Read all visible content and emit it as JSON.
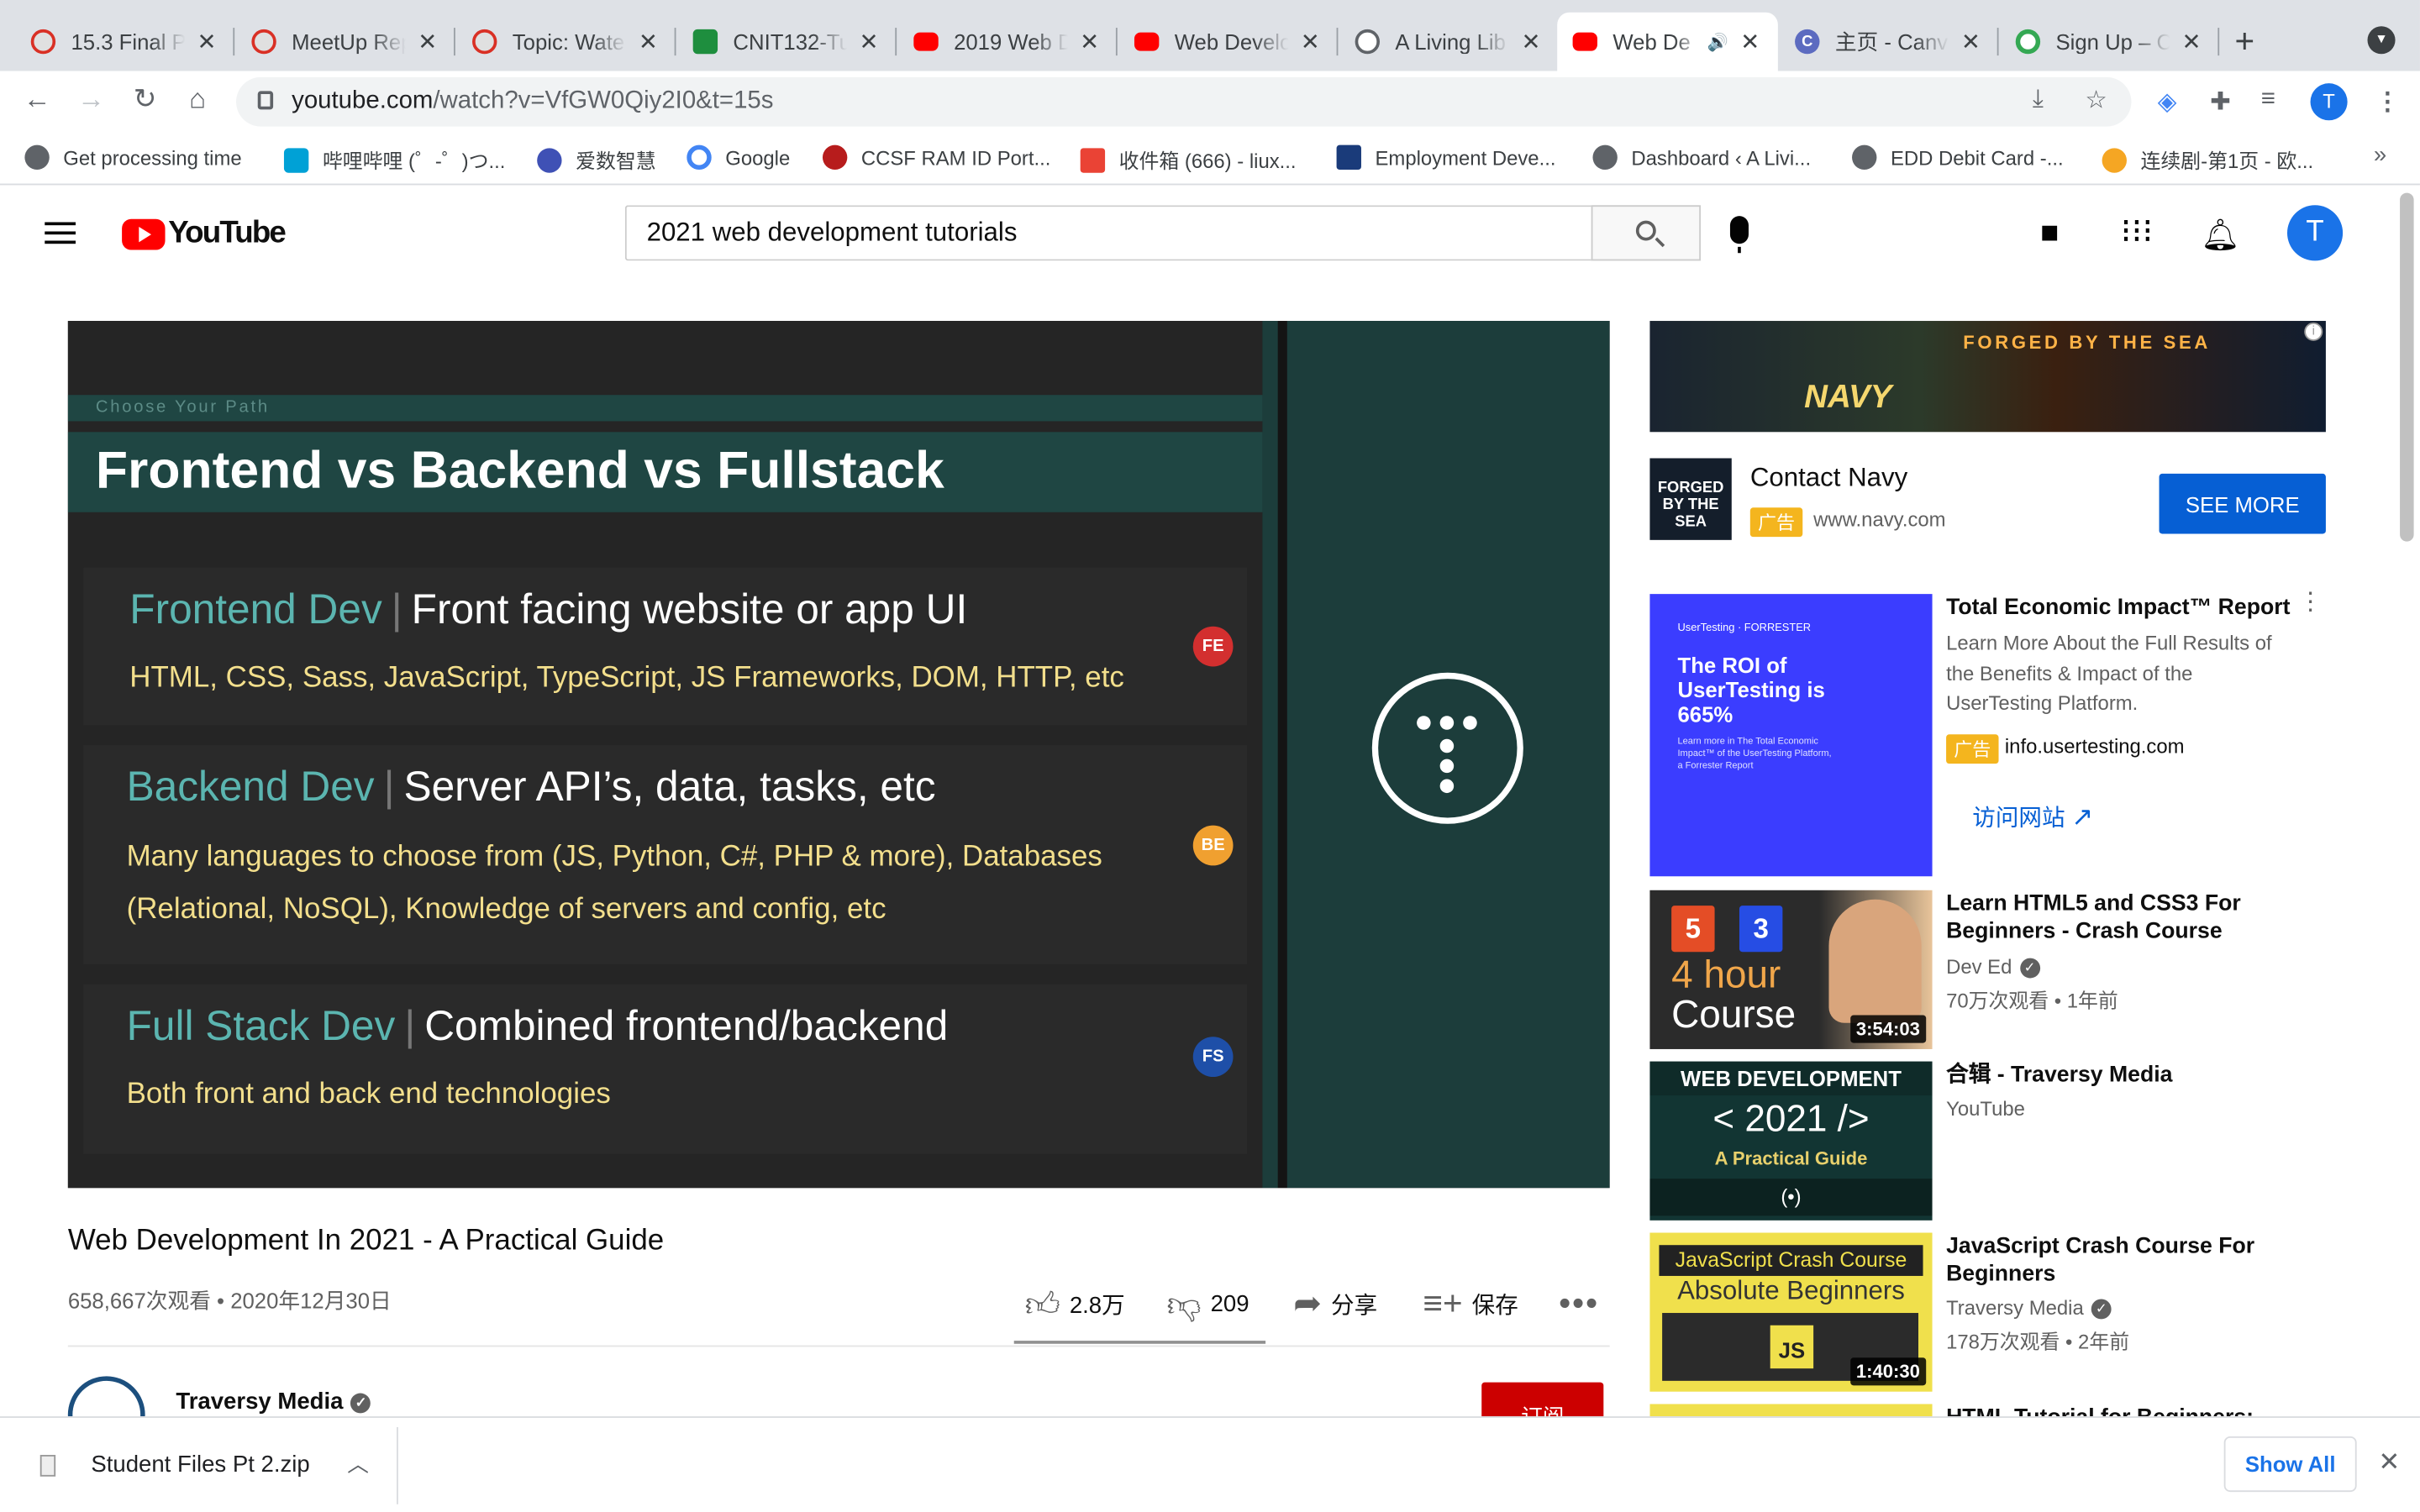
{
  "browser": {
    "tabs": [
      {
        "title": "15.3 Final P",
        "icon": "cube-icon"
      },
      {
        "title": "MeetUp Rep",
        "icon": "cube-icon"
      },
      {
        "title": "Topic: Wate",
        "icon": "cube-icon"
      },
      {
        "title": "CNIT132-Tu",
        "icon": "sheets-icon"
      },
      {
        "title": "2019 Web D",
        "icon": "youtube-icon"
      },
      {
        "title": "Web Develo",
        "icon": "youtube-icon"
      },
      {
        "title": "A Living Lib",
        "icon": "globe-icon"
      },
      {
        "title": "Web De",
        "icon": "youtube-icon",
        "active": true,
        "audio": "🔊"
      },
      {
        "title": "主页 - Canv",
        "icon": "canva-icon"
      },
      {
        "title": "Sign Up – C",
        "icon": "grammarly-icon"
      }
    ],
    "close_glyph": "✕",
    "new_tab_glyph": "+",
    "url_host": "youtube.com",
    "url_path": "/watch?v=VfGW0Qiy2I0&t=15s",
    "profile_initial": "T",
    "bookmarks": [
      {
        "label": "Get processing time",
        "color": "#5f6368"
      },
      {
        "label": "哔哩哔哩 (゜-゜)つ...",
        "color": "#00a1d6"
      },
      {
        "label": "爱数智慧",
        "color": "#3f51b5"
      },
      {
        "label": "Google",
        "color": "#4285f4"
      },
      {
        "label": "CCSF RAM ID Port...",
        "color": "#b71c1c"
      },
      {
        "label": "收件箱 (666) - liux...",
        "color": "#ea4335"
      },
      {
        "label": "Employment Deve...",
        "color": "#1a3b7a"
      },
      {
        "label": "Dashboard ‹ A Livi...",
        "color": "#5f6368"
      },
      {
        "label": "EDD Debit Card -...",
        "color": "#5f6368"
      },
      {
        "label": "连续剧-第1页 - 欧...",
        "color": "#f5a623"
      }
    ],
    "bookmarks_more": "»"
  },
  "youtube": {
    "logo_text": "YouTube",
    "search_value": "2021 web development tutorials",
    "avatar_initial": "T"
  },
  "slide": {
    "kicker": "Choose Your Path",
    "title": "Frontend vs Backend vs Fullstack",
    "rows": [
      {
        "accent": "Frontend Dev",
        "pipe": "|",
        "head": "Front facing website or app UI",
        "body": [
          "HTML, CSS, Sass, JavaScript, TypeScript, JS Frameworks, DOM, HTTP, etc"
        ],
        "badge": "FE",
        "badge_color": "#d32f2f"
      },
      {
        "accent": "Backend Dev",
        "pipe": "|",
        "head": "Server API’s, data, tasks, etc",
        "body": [
          "Many languages to choose from (JS, Python, C#, PHP & more), Databases",
          "(Relational, NoSQL), Knowledge of servers and config, etc"
        ],
        "badge": "BE",
        "badge_color": "#f0a030"
      },
      {
        "accent": "Full Stack Dev",
        "pipe": "|",
        "head": "Combined frontend/backend",
        "body": [
          "Both front and back end technologies"
        ],
        "badge": "FS",
        "badge_color": "#1e4fa8"
      }
    ]
  },
  "video": {
    "title": "Web Development In 2021 - A Practical Guide",
    "meta": "658,667次观看 • 2020年12月30日",
    "likes": "2.8万",
    "dislikes": "209",
    "share": "分享",
    "save": "保存",
    "more": "•••",
    "channel": "Traversy Media",
    "subscribe": "订阅"
  },
  "ad": {
    "banner_tagline": "FORGED BY THE SEA",
    "banner_brand": "NAVY",
    "logo_text": "FORGED BY THE SEA",
    "title": "Contact Navy",
    "tag": "广告",
    "url": "www.navy.com",
    "cta": "SEE MORE",
    "info": "i"
  },
  "sidebar": {
    "promo": {
      "thumb_top": "UserTesting · FORRESTER",
      "thumb_title": "The ROI of UserTesting is 665%",
      "thumb_body": "Learn more in The Total Economic Impact™ of the UserTesting Platform, a Forrester Report",
      "title": "Total Economic Impact™ Report",
      "body": "Learn More About the Full Results of the Benefits & Impact of the UserTesting Platform.",
      "tag": "广告",
      "url": "info.usertesting.com",
      "visit": "访问网站"
    },
    "videos": [
      {
        "title": "Learn HTML5 and CSS3 For Beginners - Crash Course",
        "channel": "Dev Ed",
        "verified": true,
        "stats": "70万次观看 • 1年前",
        "duration": "3:54:03",
        "thumb": {
          "b1": "5",
          "b2": "3",
          "big1": "4 hour",
          "big2": "Course"
        }
      },
      {
        "title": "合辑 - Traversy Media",
        "channel": "YouTube",
        "verified": false,
        "thumb": {
          "top": "WEB DEVELOPMENT",
          "year": "< 2021 />",
          "sub": "A Practical Guide",
          "icons": "(•)"
        }
      },
      {
        "title": "JavaScript Crash Course For Beginners",
        "channel": "Traversy Media",
        "verified": true,
        "stats": "178万次观看 • 2年前",
        "duration": "1:40:30",
        "thumb": {
          "top": "JavaScript Crash Course",
          "sub": "Absolute Beginners",
          "js": "JS"
        }
      },
      {
        "title": "HTML Tutorial for Beginners:"
      }
    ]
  },
  "downloads": {
    "file": "Student Files Pt 2.zip",
    "show_all": "Show All",
    "close": "✕"
  }
}
